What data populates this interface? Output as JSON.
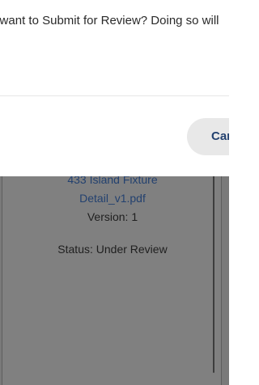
{
  "modal": {
    "message": "Are you sure you want to Submit for Review? Doing so will lock this version.",
    "cancel_label": "Cancel"
  },
  "document": {
    "name_line_1": "433 Island Fixture",
    "name_line_2": "Detail_v1.pdf",
    "version": "Version: 1",
    "status": "Status: Under Review"
  },
  "colors": {
    "link": "#23416f",
    "overlay": "#7a7a7a",
    "button_bg": "#e8e8e8"
  }
}
